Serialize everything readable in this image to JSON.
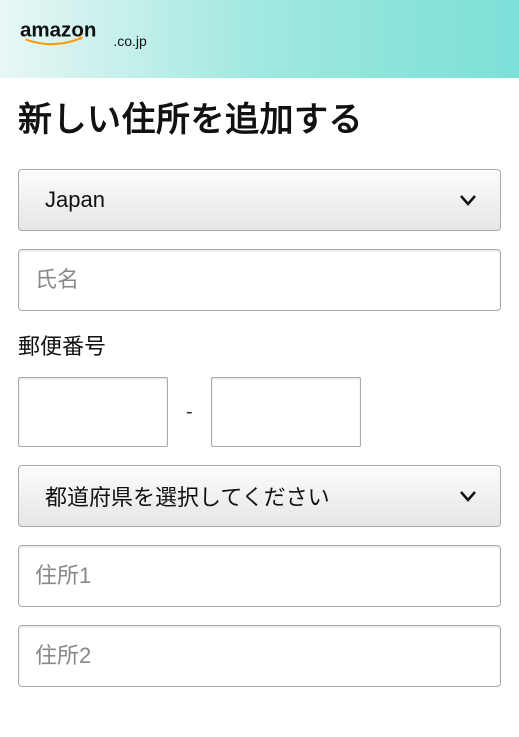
{
  "header": {
    "logo_text": "amazon",
    "logo_suffix": ".co.jp"
  },
  "title": "新しい住所を追加する",
  "country_select": {
    "value": "Japan"
  },
  "name_input": {
    "placeholder": "氏名"
  },
  "postal": {
    "label": "郵便番号",
    "separator": "-"
  },
  "prefecture_select": {
    "value": "都道府県を選択してください"
  },
  "address1_input": {
    "placeholder": "住所1"
  },
  "address2_input": {
    "placeholder": "住所2"
  }
}
